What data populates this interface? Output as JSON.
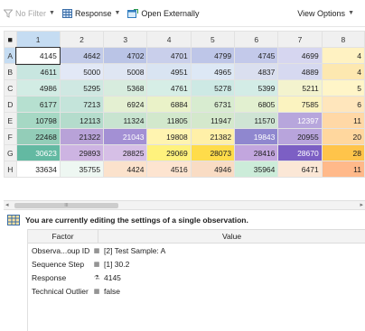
{
  "toolbar": {
    "filter_label": "No Filter",
    "response_label": "Response",
    "open_externally_label": "Open Externally",
    "view_options_label": "View Options"
  },
  "plate": {
    "corner": "■",
    "columns": [
      "1",
      "2",
      "3",
      "4",
      "5",
      "6",
      "7",
      "8"
    ],
    "rows": [
      {
        "label": "A",
        "cells": [
          {
            "v": "4145",
            "bg": "#ffffff",
            "sel": true
          },
          {
            "v": "4642",
            "bg": "#c2cbe9"
          },
          {
            "v": "4702",
            "bg": "#bac4e6"
          },
          {
            "v": "4701",
            "bg": "#c9cfeb"
          },
          {
            "v": "4799",
            "bg": "#bec6e8"
          },
          {
            "v": "4745",
            "bg": "#c3c9ea"
          },
          {
            "v": "4699",
            "bg": "#d6d6f0"
          },
          {
            "v": "4",
            "bg": "#fff2c2"
          }
        ]
      },
      {
        "label": "B",
        "cells": [
          {
            "v": "4611",
            "bg": "#c8e6e0"
          },
          {
            "v": "5000",
            "bg": "#e2e8f6"
          },
          {
            "v": "5008",
            "bg": "#dfe6f3"
          },
          {
            "v": "4951",
            "bg": "#d9e4f2"
          },
          {
            "v": "4965",
            "bg": "#dde8f5"
          },
          {
            "v": "4837",
            "bg": "#dadfef"
          },
          {
            "v": "4889",
            "bg": "#d6d9f0"
          },
          {
            "v": "4",
            "bg": "#fde8b0"
          }
        ]
      },
      {
        "label": "C",
        "cells": [
          {
            "v": "4986",
            "bg": "#d2ece4"
          },
          {
            "v": "5295",
            "bg": "#cfe8e2"
          },
          {
            "v": "5368",
            "bg": "#d7ecde"
          },
          {
            "v": "4761",
            "bg": "#d6eee6"
          },
          {
            "v": "5278",
            "bg": "#cde9e4"
          },
          {
            "v": "5399",
            "bg": "#d3ece6"
          },
          {
            "v": "5211",
            "bg": "#f3f3ce"
          },
          {
            "v": "5",
            "bg": "#fff5c8"
          }
        ]
      },
      {
        "label": "D",
        "cells": [
          {
            "v": "6177",
            "bg": "#b6e0d0"
          },
          {
            "v": "7213",
            "bg": "#c4e4da"
          },
          {
            "v": "6924",
            "bg": "#e4f0d2"
          },
          {
            "v": "6884",
            "bg": "#eaf2c8"
          },
          {
            "v": "6731",
            "bg": "#d8ecd0"
          },
          {
            "v": "6805",
            "bg": "#e2f0d0"
          },
          {
            "v": "7585",
            "bg": "#fbf3c0"
          },
          {
            "v": "6",
            "bg": "#ffe6bc"
          }
        ]
      },
      {
        "label": "E",
        "cells": [
          {
            "v": "10798",
            "bg": "#a6d8c4"
          },
          {
            "v": "12113",
            "bg": "#b4dccc"
          },
          {
            "v": "11324",
            "bg": "#c8e4d0"
          },
          {
            "v": "11805",
            "bg": "#d2e8cc"
          },
          {
            "v": "11947",
            "bg": "#d4e8cc"
          },
          {
            "v": "11570",
            "bg": "#cfe4d4"
          },
          {
            "v": "12397",
            "bg": "#b7a6dc",
            "light": true
          },
          {
            "v": "11",
            "bg": "#ffd8a6"
          }
        ]
      },
      {
        "label": "F",
        "cells": [
          {
            "v": "22468",
            "bg": "#93cdb8"
          },
          {
            "v": "21322",
            "bg": "#b8a2d8"
          },
          {
            "v": "21043",
            "bg": "#a390d4",
            "light": true
          },
          {
            "v": "19808",
            "bg": "#fff4b0"
          },
          {
            "v": "21382",
            "bg": "#fff0a8"
          },
          {
            "v": "19843",
            "bg": "#8f87cf",
            "light": true
          },
          {
            "v": "20955",
            "bg": "#b8a4dc"
          },
          {
            "v": "20",
            "bg": "#ffd79e"
          }
        ]
      },
      {
        "label": "G",
        "cells": [
          {
            "v": "30623",
            "bg": "#63b9a2",
            "light": true
          },
          {
            "v": "29893",
            "bg": "#cdb4e2"
          },
          {
            "v": "28825",
            "bg": "#d6bfe6"
          },
          {
            "v": "29069",
            "bg": "#fff27d"
          },
          {
            "v": "28073",
            "bg": "#ffdc4a"
          },
          {
            "v": "28416",
            "bg": "#c2a6de"
          },
          {
            "v": "28670",
            "bg": "#7c5fc4",
            "light": true
          },
          {
            "v": "28",
            "bg": "#ffc44a"
          }
        ]
      },
      {
        "label": "H",
        "cells": [
          {
            "v": "33634",
            "bg": "#ffffff"
          },
          {
            "v": "35755",
            "bg": "#eef7f2"
          },
          {
            "v": "4424",
            "bg": "#fbe2cc"
          },
          {
            "v": "4516",
            "bg": "#fde4d0"
          },
          {
            "v": "4946",
            "bg": "#f9dcc4"
          },
          {
            "v": "35964",
            "bg": "#ccecd9"
          },
          {
            "v": "6471",
            "bg": "#fbe7d6"
          },
          {
            "v": "11",
            "bg": "#ffb98a"
          }
        ]
      }
    ]
  },
  "scrollbar": {
    "left_arrow": "◂",
    "right_arrow": "▸",
    "thumb_grip": "III"
  },
  "info": {
    "message": "You are currently editing the settings of a single observation."
  },
  "properties": {
    "headers": {
      "factor": "Factor",
      "value": "Value"
    },
    "rows": [
      {
        "factor": "Observa...oup ID",
        "icon": "▦",
        "value": "[2] Test Sample: A"
      },
      {
        "factor": "Sequence Step",
        "icon": "▦",
        "value": "[1] 30.2"
      },
      {
        "factor": "Response",
        "icon": "⚗",
        "value": "4145"
      },
      {
        "factor": "Technical Outlier",
        "icon": "▦",
        "value": "false"
      }
    ]
  }
}
